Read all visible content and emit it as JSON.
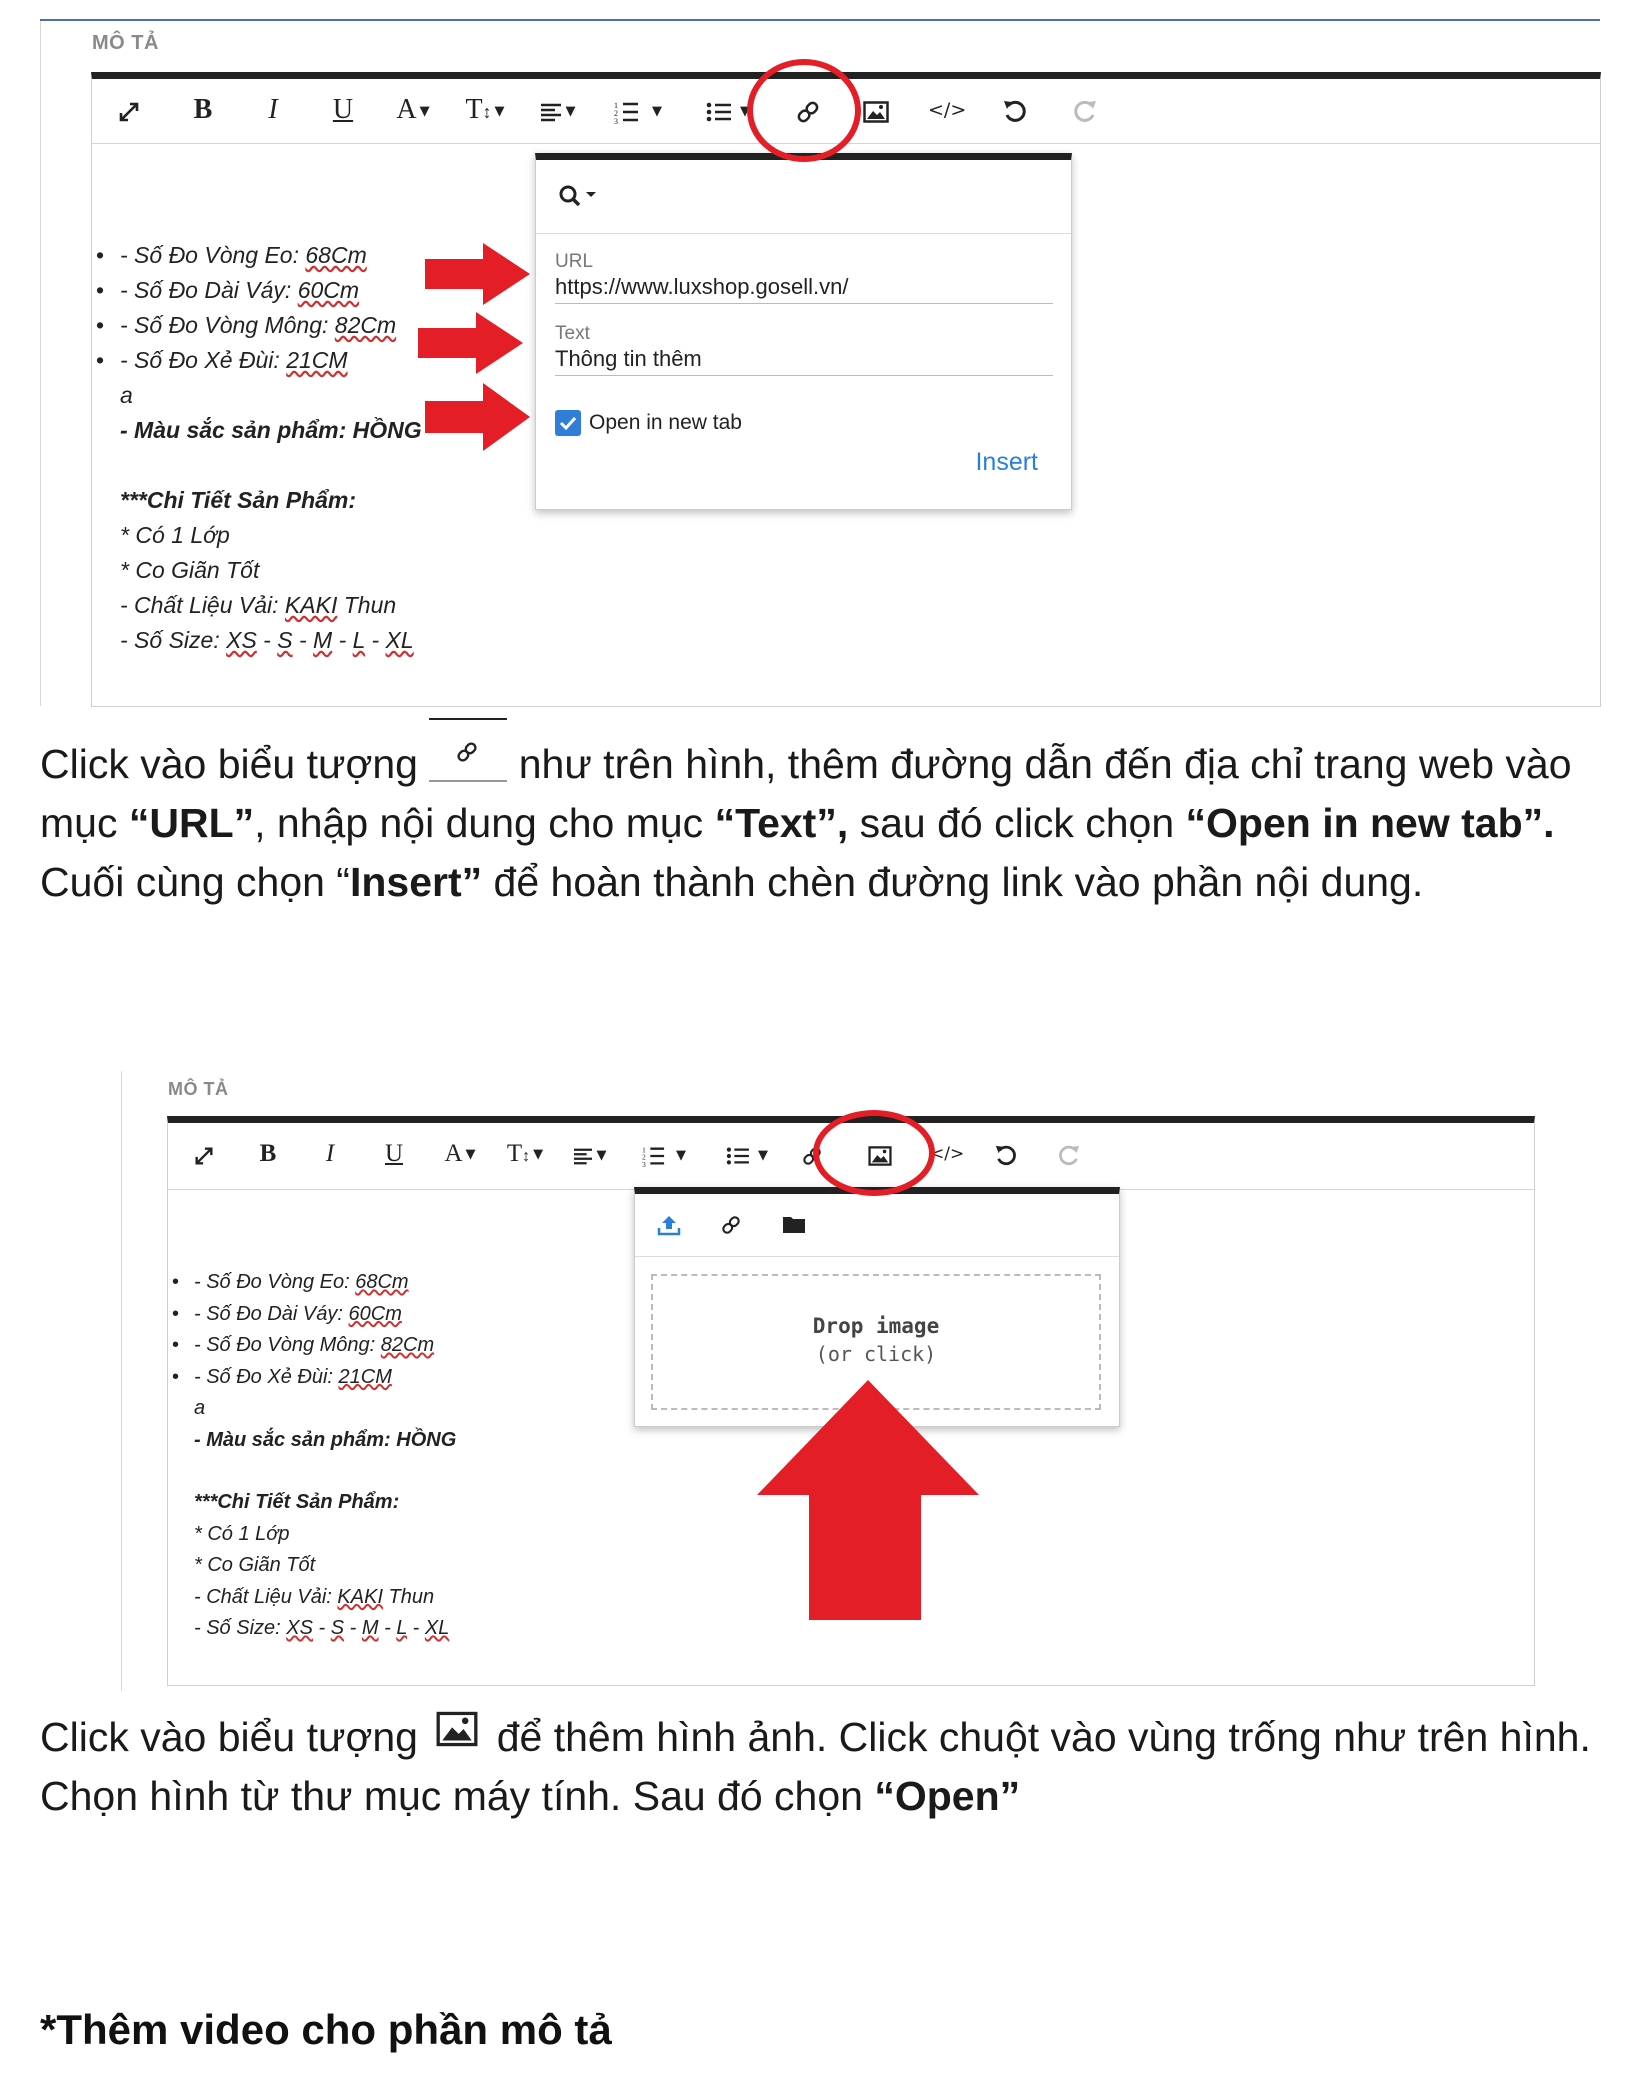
{
  "screenshot1": {
    "section_label": "MÔ TẢ",
    "list_items": [
      {
        "prefix": "- Số Đo Vòng Eo: ",
        "value": "68Cm"
      },
      {
        "prefix": "- Số Đo Dài Váy: ",
        "value": "60Cm"
      },
      {
        "prefix": "- Số Đo Vòng Mông: ",
        "value": "82Cm"
      },
      {
        "prefix": "- Số Đo Xẻ Đùi: ",
        "value": "21CM"
      }
    ],
    "line_a": "a",
    "color_line": "- Màu sắc sản phẩm: HỒNG",
    "detail_title": "***Chi Tiết Sản Phẩm:",
    "detail_1": "* Có 1 Lớp",
    "detail_2": "* Co Giãn Tốt",
    "material_prefix": "- Chất Liệu Vải: ",
    "material_value": "KAKI",
    "material_suffix": " Thun",
    "size_prefix": "- Số Size: ",
    "sizes": [
      "XS",
      "S",
      "M",
      "L",
      "XL"
    ],
    "size_sep": " - ",
    "link_popup": {
      "url_label": "URL",
      "url_value": "https://www.luxshop.gosell.vn/",
      "text_label": "Text",
      "text_value": "Thông tin thêm",
      "checkbox_label": "Open in new tab",
      "checkbox_checked": true,
      "insert_label": "Insert"
    }
  },
  "paragraph1": {
    "t1": "Click vào biểu tượng ",
    "t2": " như trên hình, thêm đường dẫn đến địa chỉ trang web vào mục ",
    "b1": "“URL”",
    "t3": ", nhập nội dung cho mục  ",
    "b2": "“Text”,",
    "t4": " sau đó click chọn ",
    "b3": "“Open in new tab”.",
    "t5": " Cuối cùng chọn “",
    "b4": "Insert”",
    "t6": "  để hoàn thành chèn đường link vào phần nội dung."
  },
  "screenshot2": {
    "section_label": "MÔ TẢ",
    "image_popup": {
      "drop_title": "Drop image",
      "drop_sub": "(or click)"
    }
  },
  "paragraph2": {
    "t1": "Click vào biểu tượng ",
    "t2": " để thêm hình ảnh. Click chuột vào vùng trống như trên hình. Chọn hình từ thư mục máy tính. Sau đó chọn ",
    "b1": "“Open”"
  },
  "heading": "*Thêm video cho phần mô tả",
  "colors": {
    "accent_red": "#e31e26",
    "insert_blue": "#2b7fd6",
    "checkbox_blue": "#2f7fd8"
  },
  "icons": [
    "fullscreen-icon",
    "bold-icon",
    "italic-icon",
    "underline-icon",
    "font-color-icon",
    "font-size-icon",
    "align-icon",
    "ordered-list-icon",
    "unordered-list-icon",
    "link-icon",
    "image-icon",
    "code-view-icon",
    "undo-icon",
    "redo-icon",
    "search-icon",
    "upload-icon",
    "folder-icon",
    "checkbox-icon",
    "arrow-right-icon",
    "arrow-up-icon"
  ]
}
